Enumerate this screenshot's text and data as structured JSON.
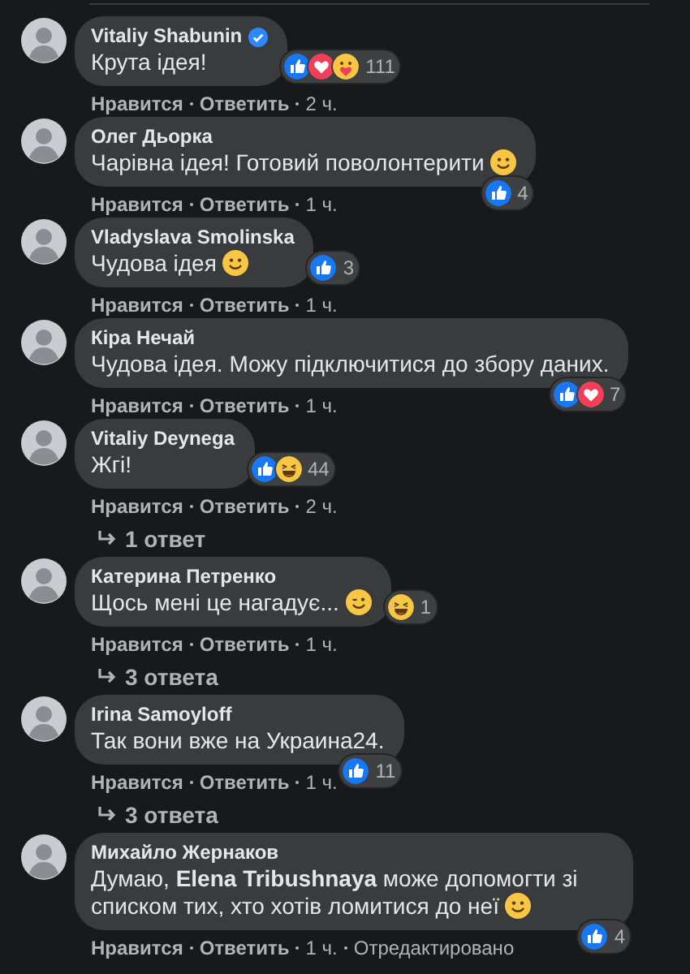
{
  "comments": [
    {
      "author": "Vitaliy Shabunin",
      "verified": true,
      "text": "Крута ідея!",
      "reactions": {
        "icons": [
          {
            "kind": "like"
          },
          {
            "kind": "love"
          },
          {
            "kind": "care"
          }
        ],
        "count": "111"
      },
      "actions": {
        "like": "Нравится",
        "reply": "Ответить",
        "time": "2 ч."
      }
    },
    {
      "author": "Олег Дьорка",
      "verified": false,
      "text": "Чарівна ідея! Готовий поволонтерити",
      "emoji": {
        "kind": "smile"
      },
      "reactions": {
        "icons": [
          {
            "kind": "like"
          }
        ],
        "count": "4"
      },
      "actions": {
        "like": "Нравится",
        "reply": "Ответить",
        "time": "1 ч."
      }
    },
    {
      "author": "Vladyslava Smolinska",
      "verified": false,
      "text": "Чудова ідея",
      "emoji": {
        "kind": "smile"
      },
      "reactions": {
        "icons": [
          {
            "kind": "like"
          }
        ],
        "count": "3"
      },
      "actions": {
        "like": "Нравится",
        "reply": "Ответить",
        "time": "1 ч."
      }
    },
    {
      "author": "Кіра Нечай",
      "verified": false,
      "text": "Чудова ідея. Можу підключитися до збору даних.",
      "reactions": {
        "icons": [
          {
            "kind": "like"
          },
          {
            "kind": "love"
          }
        ],
        "count": "7"
      },
      "actions": {
        "like": "Нравится",
        "reply": "Ответить",
        "time": "1 ч."
      }
    },
    {
      "author": "Vitaliy Deynega",
      "verified": false,
      "text": "Жгі!",
      "reactions": {
        "icons": [
          {
            "kind": "like"
          },
          {
            "kind": "haha"
          }
        ],
        "count": "44"
      },
      "actions": {
        "like": "Нравится",
        "reply": "Ответить",
        "time": "2 ч."
      },
      "replies": "1 ответ"
    },
    {
      "author": "Катерина Петренко",
      "verified": false,
      "text": "Щось мені це нагадує...",
      "emoji": {
        "kind": "wink"
      },
      "reactions": {
        "icons": [
          {
            "kind": "haha"
          }
        ],
        "count": "1"
      },
      "actions": {
        "like": "Нравится",
        "reply": "Ответить",
        "time": "1 ч."
      },
      "replies": "3 ответа"
    },
    {
      "author": "Irina Samoyloff",
      "verified": false,
      "text": "Так вони вже на Украина24.",
      "reactions": {
        "icons": [
          {
            "kind": "like"
          }
        ],
        "count": "11"
      },
      "actions": {
        "like": "Нравится",
        "reply": "Ответить",
        "time": "1 ч."
      },
      "replies": "3 ответа"
    },
    {
      "author": "Михайло Жернаков",
      "verified": false,
      "text": "Думаю, **Elena Tribushnaya** може допомогти зі списком тих, хто хотів ломитися до неї",
      "emoji": {
        "kind": "smile"
      },
      "reactions": {
        "icons": [
          {
            "kind": "like"
          }
        ],
        "count": "4"
      },
      "actions": {
        "like": "Нравится",
        "reply": "Ответить",
        "time": "1 ч.",
        "edited": "Отредактировано"
      }
    }
  ]
}
